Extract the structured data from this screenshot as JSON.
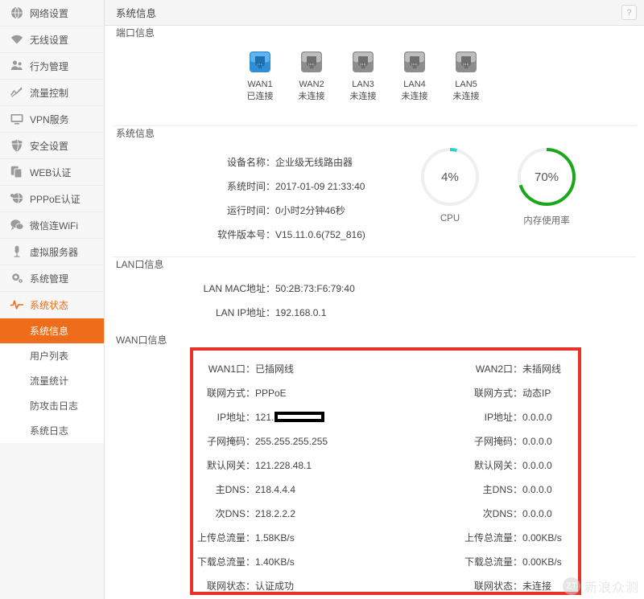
{
  "sidebar": {
    "items": [
      {
        "label": "网络设置",
        "icon": "globe-icon"
      },
      {
        "label": "无线设置",
        "icon": "wifi-icon"
      },
      {
        "label": "行为管理",
        "icon": "people-icon"
      },
      {
        "label": "流量控制",
        "icon": "chart-line-icon"
      },
      {
        "label": "VPN服务",
        "icon": "monitor-icon"
      },
      {
        "label": "安全设置",
        "icon": "shield-globe-icon"
      },
      {
        "label": "WEB认证",
        "icon": "copy-icon"
      },
      {
        "label": "PPPoE认证",
        "icon": "key-globe-icon"
      },
      {
        "label": "微信连WiFi",
        "icon": "chat-icon"
      },
      {
        "label": "虚拟服务器",
        "icon": "server-icon"
      },
      {
        "label": "系统管理",
        "icon": "gear-icon"
      },
      {
        "label": "系统状态",
        "icon": "pulse-icon",
        "active": true
      }
    ],
    "subitems": [
      {
        "label": "系统信息",
        "selected": true
      },
      {
        "label": "用户列表",
        "selected": false
      },
      {
        "label": "流量统计",
        "selected": false
      },
      {
        "label": "防攻击日志",
        "selected": false
      },
      {
        "label": "系统日志",
        "selected": false
      }
    ],
    "accent_color": "#ef6c1a"
  },
  "header": {
    "title": "系统信息",
    "help_label": "?"
  },
  "ports_section": {
    "label": "端口信息",
    "ports": [
      {
        "name": "WAN1",
        "status": "已连接",
        "connected": true
      },
      {
        "name": "WAN2",
        "status": "未连接",
        "connected": false
      },
      {
        "name": "LAN3",
        "status": "未连接",
        "connected": false
      },
      {
        "name": "LAN4",
        "status": "未连接",
        "connected": false
      },
      {
        "name": "LAN5",
        "status": "未连接",
        "connected": false
      }
    ]
  },
  "system_section": {
    "label": "系统信息",
    "rows": [
      {
        "key": "设备名称",
        "value": "企业级无线路由器"
      },
      {
        "key": "系统时间",
        "value": "2017-01-09 21:33:40"
      },
      {
        "key": "运行时间",
        "value": "0小时2分钟46秒"
      },
      {
        "key": "软件版本号",
        "value": "V15.11.0.6(752_816)"
      }
    ],
    "gauges": [
      {
        "label": "CPU",
        "percent_text": "4%",
        "percent": 4,
        "color": "#2ad3c5",
        "track": "#efefef"
      },
      {
        "label": "内存使用率",
        "percent_text": "70%",
        "percent": 70,
        "color": "#18a81a",
        "track": "#efefef"
      }
    ]
  },
  "lan_section": {
    "label": "LAN口信息",
    "rows": [
      {
        "key": "LAN MAC地址",
        "value": "50:2B:73:F6:79:40"
      },
      {
        "key": "LAN IP地址",
        "value": "192.168.0.1"
      }
    ]
  },
  "wan_section": {
    "label": "WAN口信息",
    "highlight_color": "#e8312b",
    "wan1": [
      {
        "key": "WAN1口",
        "value": "已插网线"
      },
      {
        "key": "联网方式",
        "value": "PPPoE"
      },
      {
        "key": "IP地址",
        "value": "121.",
        "redacted": true
      },
      {
        "key": "子网掩码",
        "value": "255.255.255.255"
      },
      {
        "key": "默认网关",
        "value": "121.228.48.1"
      },
      {
        "key": "主DNS",
        "value": "218.4.4.4"
      },
      {
        "key": "次DNS",
        "value": "218.2.2.2"
      },
      {
        "key": "上传总流量",
        "value": "1.58KB/s"
      },
      {
        "key": "下载总流量",
        "value": "1.40KB/s"
      },
      {
        "key": "联网状态",
        "value": "认证成功"
      }
    ],
    "wan2": [
      {
        "key": "WAN2口",
        "value": "未插网线"
      },
      {
        "key": "联网方式",
        "value": "动态IP"
      },
      {
        "key": "IP地址",
        "value": "0.0.0.0"
      },
      {
        "key": "子网掩码",
        "value": "0.0.0.0"
      },
      {
        "key": "默认网关",
        "value": "0.0.0.0"
      },
      {
        "key": "主DNS",
        "value": "0.0.0.0"
      },
      {
        "key": "次DNS",
        "value": "0.0.0.0"
      },
      {
        "key": "上传总流量",
        "value": "0.00KB/s"
      },
      {
        "key": "下载总流量",
        "value": "0.00KB/s"
      },
      {
        "key": "联网状态",
        "value": "未连接"
      }
    ]
  },
  "watermark": {
    "text": "新浪众测",
    "mark": "ZT"
  },
  "separator": "："
}
